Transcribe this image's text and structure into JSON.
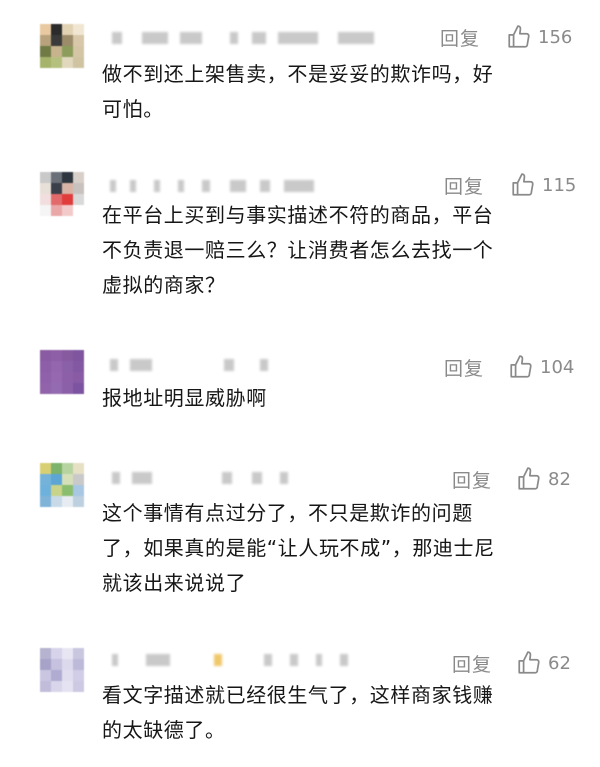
{
  "comments": [
    {
      "reply_label": "回复",
      "likes": "156",
      "text": "做不到还上架售卖，不是妥妥的欺诈吗，好\n可怕。",
      "avatar_colors": [
        "#e8c9a0",
        "#2b2b2b",
        "#e2d2b4",
        "#f0e6d2",
        "#b7a27c",
        "#3a3a3a",
        "#9c8c6a",
        "#d8c7a8",
        "#6f7a45",
        "#c7b48e",
        "#8b9c5b",
        "#d4c6a5",
        "#a6b46b",
        "#b6c07e",
        "#e0d7bc",
        "#cfc3a2"
      ]
    },
    {
      "reply_label": "回复",
      "likes": "115",
      "text": "在平台上买到与事实描述不符的商品，平台\n不负责退一赔三么？让消费者怎么去找一个\n虚拟的商家？",
      "avatar_colors": [
        "#c9c9c9",
        "#6a6f78",
        "#2e3640",
        "#d7cfc8",
        "#e7e0d8",
        "#3a3f4a",
        "#d9b3a6",
        "#c8c2be",
        "#f2dede",
        "#e26a6a",
        "#e03c3c",
        "#d9d9d9",
        "#f5f5f5",
        "#eaa7a7",
        "#f3caca",
        "#ffffff"
      ]
    },
    {
      "reply_label": "回复",
      "likes": "104",
      "text": "报地址明显威胁啊",
      "avatar_colors": [
        "#8a5ba3",
        "#8e5fa7",
        "#875aa0",
        "#7f55a0",
        "#8c5fa8",
        "#9366ad",
        "#8a60a8",
        "#8358a2",
        "#8e61aa",
        "#9668b0",
        "#8d5fa8",
        "#885ba4",
        "#9063ab",
        "#946bb1",
        "#8c60a8",
        "#7c53a0"
      ]
    },
    {
      "reply_label": "回复",
      "likes": "82",
      "text": "这个事情有点过分了，不只是欺诈的问题\n了，如果真的是能“让人玩不成”，那迪士尼\n就该出来说说了",
      "avatar_colors": [
        "#d8cf73",
        "#7db36a",
        "#b6d4a0",
        "#e6e0c5",
        "#74b2d9",
        "#5da5d4",
        "#d6e0b8",
        "#c9c9c9",
        "#6fb1dd",
        "#c9d48a",
        "#8bbd6e",
        "#a8c7e3",
        "#7fb3d8",
        "#c8d9e8",
        "#e7ecf2",
        "#bcd0df"
      ]
    },
    {
      "reply_label": "回复",
      "likes": "62",
      "text": "看文字描述就已经很生气了，这样商家钱赚\n的太缺德了。",
      "avatar_colors": [
        "#b5b3cf",
        "#d6d3ea",
        "#e8e6f3",
        "#c9c6e0",
        "#a7a3c8",
        "#c5c1de",
        "#dcd9ec",
        "#bdb9d8",
        "#cac6e2",
        "#b0abd0",
        "#e0ddef",
        "#d1cde6",
        "#c0bcda",
        "#d9d6eb",
        "#e5e3f2",
        "#cdc9e3"
      ]
    }
  ]
}
